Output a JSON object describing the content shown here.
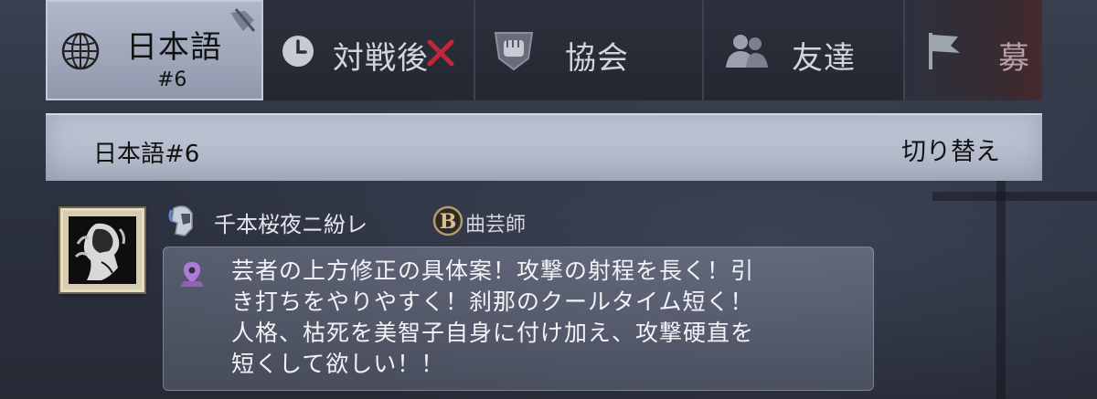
{
  "tabs": [
    {
      "label": "日本語",
      "sub": "#6",
      "icon": "globe-icon",
      "active": true
    },
    {
      "label": "対戦後",
      "icon": "clock-icon",
      "badge": "close-icon"
    },
    {
      "label": "協会",
      "icon": "fist-shield-icon"
    },
    {
      "label": "友達",
      "icon": "friends-icon"
    },
    {
      "label": "募",
      "icon": "flag-icon"
    }
  ],
  "channel": {
    "name": "日本語#6",
    "switch_label": "切り替え"
  },
  "message": {
    "username": "千本桜夜ニ紛レ",
    "role_badge": "B",
    "role": "曲芸師",
    "text_lines": [
      "芸者の上方修正の具体案！攻撃の射程を長く！引",
      "き打ちをやりやすく！刹那のクールタイム短く！",
      "人格、枯死を美智子自身に付け加え、攻撃硬直を",
      "短くして欲しい！！"
    ]
  },
  "colors": {
    "active_tab": "#a6aec1",
    "channel_bar": "#b7bfcf",
    "badge_red": "#c0283a",
    "pin_purple": "#b07ad8"
  }
}
